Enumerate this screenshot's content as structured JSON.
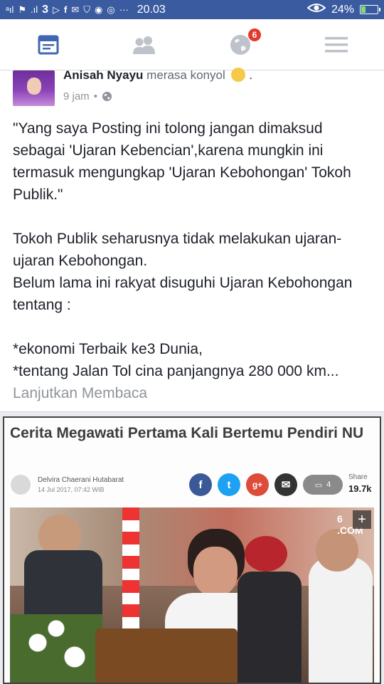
{
  "status_bar": {
    "left_icons": [
      "sim-signal-icon",
      "flag-icon",
      "signal-bars-icon",
      "three-icon",
      "play-icon",
      "facebook-icon",
      "mail-icon",
      "shield-icon",
      "messenger-icon",
      "instagram-icon",
      "more-dots-icon"
    ],
    "time": "20.03",
    "battery_percent": "24%",
    "battery_level": 0.24
  },
  "nav": {
    "tabs": [
      {
        "name": "news-feed",
        "icon": "news-feed-icon",
        "active": true
      },
      {
        "name": "friends",
        "icon": "friends-icon",
        "active": false
      },
      {
        "name": "notifications",
        "icon": "globe-icon",
        "active": false,
        "badge": "6"
      },
      {
        "name": "menu",
        "icon": "hamburger-icon",
        "active": false
      }
    ]
  },
  "post": {
    "author": "Anisah Nyayu",
    "feeling": "merasa konyol",
    "feeling_end": ".",
    "time": "9 jam",
    "separator": "•",
    "privacy_icon": "globe-icon",
    "paragraphs": [
      "\"Yang saya Posting ini tolong jangan dimaksud sebagai 'Ujaran Kebencian',karena mungkin ini termasuk mengungkap  'Ujaran Kebohongan' Tokoh Publik.\"",
      "Tokoh Publik seharusnya tidak melakukan ujaran-ujaran Kebohongan.",
      "Belum lama ini rakyat disuguhi Ujaran Kebohongan tentang :",
      "*ekonomi Terbaik ke3 Dunia,",
      "*tentang Jalan Tol cina panjangnya 280 000 km..."
    ],
    "read_more": "Lanjutkan Membaca"
  },
  "link_preview": {
    "title": "Cerita Megawati Pertama Kali Bertemu Pendiri NU",
    "byline_name": "Delvira Chaerani Hutabarat",
    "byline_date": "14 Jul 2017, 07:42 WIB",
    "share_buttons": [
      {
        "icon": "facebook-icon",
        "glyph": "f",
        "color": "#3b5998"
      },
      {
        "icon": "twitter-icon",
        "glyph": "t",
        "color": "#1da1f2"
      },
      {
        "icon": "google-plus-icon",
        "glyph": "g+",
        "color": "#dd4b39"
      },
      {
        "icon": "mail-icon",
        "glyph": "✉",
        "color": "#333333"
      }
    ],
    "comment_count": "4",
    "share_label": "Share",
    "share_count": "19.7k",
    "watermark": "6 .COM",
    "plus_label": "+"
  },
  "colors": {
    "facebook_blue": "#3b5ba0",
    "active_tab": "#4267b2",
    "inactive_tab": "#bec2c9",
    "badge_red": "#e23a2b",
    "text": "#1d2129",
    "muted": "#90949c"
  }
}
